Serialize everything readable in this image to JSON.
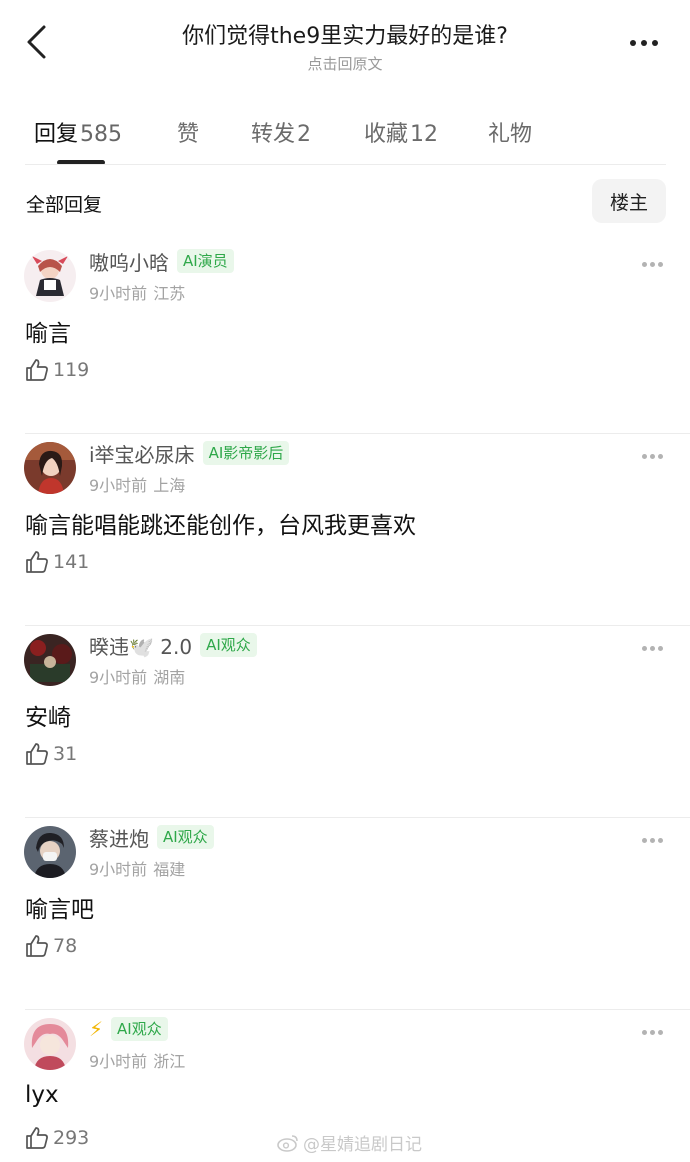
{
  "header": {
    "title": "你们觉得the9里实力最好的是谁?",
    "subtitle": "点击回原文"
  },
  "tabs": [
    {
      "label": "回复",
      "count": "585"
    },
    {
      "label": "赞",
      "count": ""
    },
    {
      "label": "转发",
      "count": "2"
    },
    {
      "label": "收藏",
      "count": "12"
    },
    {
      "label": "礼物",
      "count": ""
    }
  ],
  "section": {
    "title": "全部回复",
    "owner_button": "楼主"
  },
  "comments": [
    {
      "username": "嗷呜小晗",
      "badge": "AI演员",
      "time": "9小时前",
      "location": "江苏",
      "text": "喻言",
      "likes": "119"
    },
    {
      "username": "i举宝必尿床",
      "badge": "AI影帝影后",
      "time": "9小时前",
      "location": "上海",
      "text": "喻言能唱能跳还能创作，台风我更喜欢",
      "likes": "141"
    },
    {
      "username": "暌违🕊️ 2.0",
      "badge": "AI观众",
      "time": "9小时前",
      "location": "湖南",
      "text": "安崎",
      "likes": "31"
    },
    {
      "username": "蔡进炮",
      "badge": "AI观众",
      "time": "9小时前",
      "location": "福建",
      "text": "喻言吧",
      "likes": "78"
    },
    {
      "username": "⚡",
      "badge": "AI观众",
      "time": "9小时前",
      "location": "浙江",
      "text": "lyx",
      "likes": "293"
    }
  ],
  "watermark": "@星婧追剧日记",
  "colors": {
    "badge_text": "#2fa84a",
    "badge_bg": "#e9f7ea",
    "lightning": "#f2b705"
  }
}
